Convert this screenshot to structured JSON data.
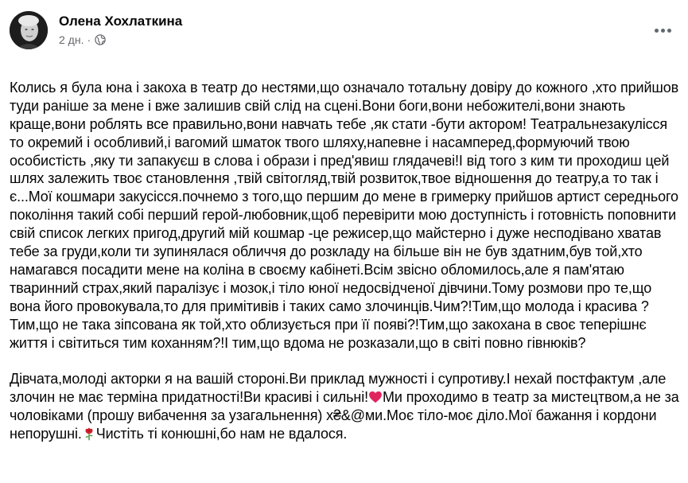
{
  "post": {
    "author": "Олена Хохлаткина",
    "time": "2 дн.",
    "separator": "·",
    "audience_icon": "globe-icon",
    "more_icon": "more-options-icon",
    "paragraph_1": "Колись я була юна  і закоха в театр до нестями,що означало  тотальну довіру до кожного ,хто прийшов туди раніше за мене і вже залишив свій слід на сцені.Вони боги,вони небожителі,вони знають краще,вони роблять все правильно,вони навчать тебе ,як стати -бути актором! Театральнезакулісся то окремий і особливий,і вагомий шматок твого шляху,напевне і насамперед,формуючий твою особистість ,яку ти запакуєш в слова і образи і пред'явиш глядачеві!І від того з ким ти проходиш цей шлях залежить твоє становлення ,твій світогляд,твій розвиток,твое відношення до театру,а то так і є...Мої кошмари закусісся.почнемо з того,що першим до мене в гримерку прийшов артист середнього покоління такий собі перший герой-любовник,щоб перевірити мою доступність і готовність поповнити свій список легких пригод,другий мій кошмар -це  режисер,що майстерно і дуже несподівано хватав тебе за груди,коли ти зупинялася обличчя до розкладу на більше він не був здатним,був той,хто намагався посадити мене на коліна в своєму кабінеті.Всім звісно обломилось,але я пам'ятаю тваринний страх,який паралізує і мозок,і тіло юної недосвідченої дівчини.Тому розмови про те,що вона його провокувала,то для примітивів і таких само злочинців.Чим?!Тим,що молода і красива ?Тим,що не така зіпсована як той,хто облизується при її появі?!Тим,що  закохана в своє теперішнє життя і світиться тим коханням?!І тим,що вдома не розказали,що в світі повно гівнюків?",
    "paragraph_2_a": "Дівчата,молоді акторки я на вашій стороні.Ви приклад мужності і супротиву.І нехай постфактум ,але злочин не має терміна придатності!Ви красиві і сильні!",
    "emoji_1": "red-heart",
    "paragraph_2_b": "Ми проходимо в театр за мистецтвом,а не за чоловіками (прошу вибачення за узагальнення) х₴&@ми.Моє тіло-моє діло.Мої бажання  і кордони непорушні.",
    "emoji_2": "rose",
    "paragraph_2_c": "Чистіть ті конюшні,бо нам не вдалося.",
    "colors": {
      "text": "#050505",
      "secondary": "#65676b",
      "heart": "#e0245e",
      "rose": "#d0202d"
    }
  }
}
